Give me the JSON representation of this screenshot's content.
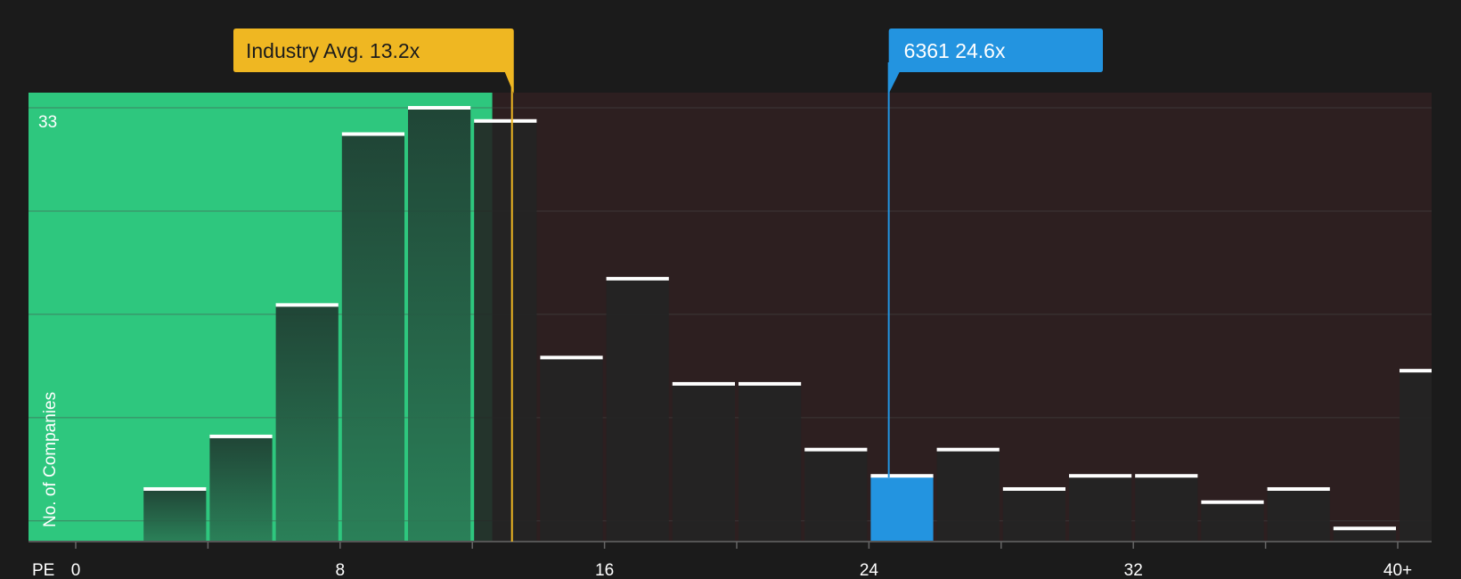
{
  "chart_data": {
    "type": "bar",
    "ylabel": "No. of Companies",
    "xlabel": "PE",
    "y_max_label": "33",
    "ylim": [
      0,
      33
    ],
    "x_ticks": [
      "0",
      "8",
      "16",
      "24",
      "32",
      "40+"
    ],
    "bins": [
      {
        "x0": 0,
        "x1": 2,
        "value": 0
      },
      {
        "x0": 2,
        "x1": 4,
        "value": 4
      },
      {
        "x0": 4,
        "x1": 6,
        "value": 8
      },
      {
        "x0": 6,
        "x1": 8,
        "value": 18
      },
      {
        "x0": 8,
        "x1": 10,
        "value": 31
      },
      {
        "x0": 10,
        "x1": 12,
        "value": 33
      },
      {
        "x0": 12,
        "x1": 14,
        "value": 32
      },
      {
        "x0": 14,
        "x1": 16,
        "value": 14
      },
      {
        "x0": 16,
        "x1": 18,
        "value": 20
      },
      {
        "x0": 18,
        "x1": 20,
        "value": 12
      },
      {
        "x0": 20,
        "x1": 22,
        "value": 12
      },
      {
        "x0": 22,
        "x1": 24,
        "value": 7
      },
      {
        "x0": 24,
        "x1": 26,
        "value": 5,
        "highlight": true
      },
      {
        "x0": 26,
        "x1": 28,
        "value": 7
      },
      {
        "x0": 28,
        "x1": 30,
        "value": 4
      },
      {
        "x0": 30,
        "x1": 32,
        "value": 5
      },
      {
        "x0": 32,
        "x1": 34,
        "value": 5
      },
      {
        "x0": 34,
        "x1": 36,
        "value": 3
      },
      {
        "x0": 36,
        "x1": 38,
        "value": 4
      },
      {
        "x0": 38,
        "x1": 40,
        "value": 1
      },
      {
        "x0": 40,
        "x1": 42,
        "value": 13
      }
    ],
    "industry_avg": {
      "label": "Industry Avg. 13.2x",
      "value": 13.2
    },
    "company": {
      "label": "6361 24.6x",
      "value": 24.6
    },
    "colors": {
      "below_region": "#2ec77e",
      "above_region": "#2d1f20",
      "bar": "#232323",
      "bar_cap": "#ffffff",
      "highlight_bar": "#2394e0",
      "industry": "#efb722",
      "company": "#2394e0",
      "grid": "#4a4a4a",
      "background": "#1b1b1b"
    }
  }
}
